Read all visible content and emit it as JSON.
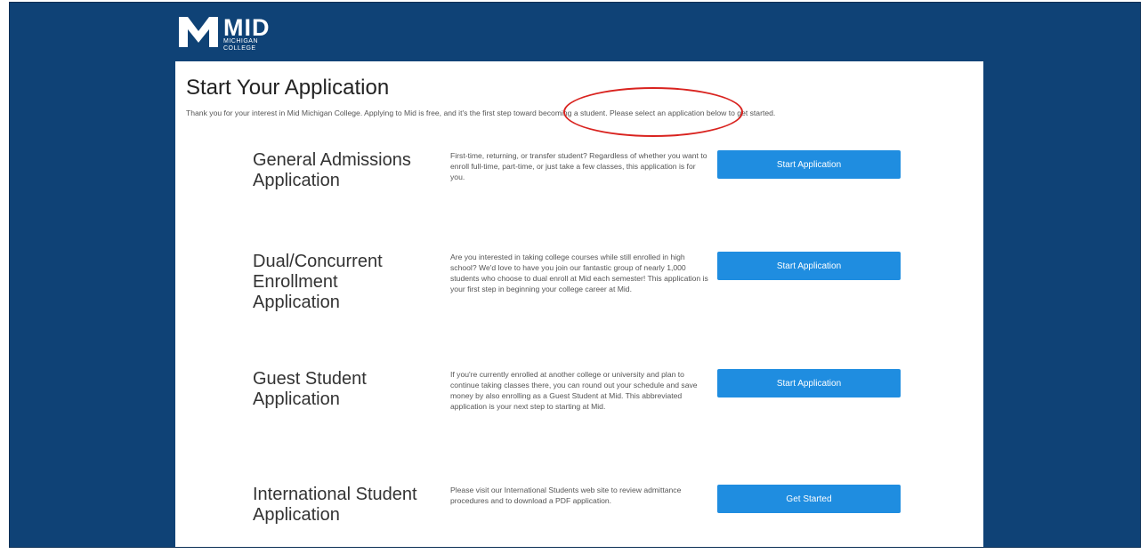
{
  "logo": {
    "main": "MID",
    "sub_line1": "MICHIGAN",
    "sub_line2": "COLLEGE"
  },
  "page": {
    "title": "Start Your Application",
    "intro": "Thank you for your interest in Mid Michigan College. Applying to Mid is free, and it's the first step toward becoming a student. Please select an application below to get started."
  },
  "applications": [
    {
      "title": "General Admissions Application",
      "description": "First-time, returning, or transfer student? Regardless of whether you want to enroll full-time, part-time, or just take a few classes, this application is for you.",
      "button": "Start Application"
    },
    {
      "title": "Dual/Concurrent Enrollment Application",
      "description": "Are you interested in taking college courses while still enrolled in high school? We'd love to have you join our fantastic group of nearly 1,000 students who choose to dual enroll at Mid each semester! This application is your first step in beginning your college career at Mid.",
      "button": "Start Application"
    },
    {
      "title": "Guest Student Application",
      "description": "If you're currently enrolled at another college or university and plan to continue taking classes there, you can round out your schedule and save money by also enrolling as a Guest Student at Mid. This abbreviated application is your next step to starting at Mid.",
      "button": "Start Application"
    },
    {
      "title": "International Student Application",
      "description": "Please visit our International Students web site to review admittance procedures and to download a PDF application.",
      "button": "Get Started"
    }
  ],
  "colors": {
    "page_background": "#0f4276",
    "button": "#1f8de0",
    "annotation_circle": "#d9231f"
  }
}
